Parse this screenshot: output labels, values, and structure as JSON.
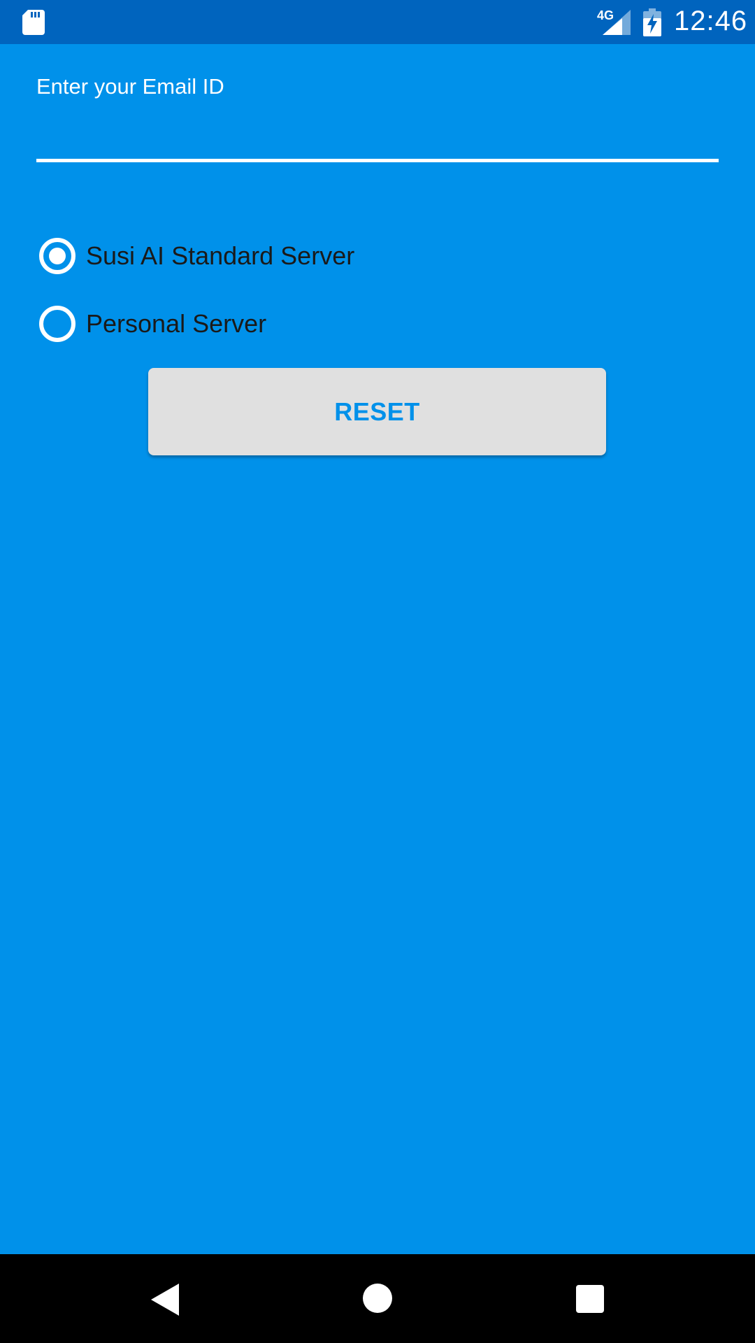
{
  "status_bar": {
    "network": "4G",
    "time": "12:46",
    "icons": [
      "sd-card-icon",
      "signal-icon",
      "battery-charging-icon"
    ]
  },
  "email": {
    "hint": "Enter your Email ID",
    "value": ""
  },
  "server_options": [
    {
      "label": "Susi AI Standard Server",
      "selected": true
    },
    {
      "label": "Personal Server",
      "selected": false
    }
  ],
  "reset_button": {
    "label": "RESET"
  },
  "nav_bar": {
    "icons": [
      "back-icon",
      "home-icon",
      "recents-icon"
    ]
  },
  "colors": {
    "background": "#0091EA",
    "status_bar": "#0064BE",
    "button": "#E0E0E0",
    "button_text": "#0091EA",
    "nav_bar": "#000000"
  }
}
